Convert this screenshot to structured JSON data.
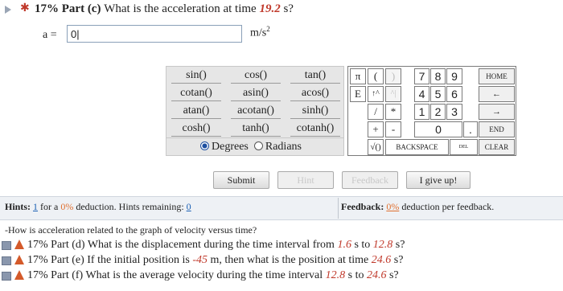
{
  "question": {
    "percent": "17%",
    "part": "Part (c)",
    "text_before": "What is the acceleration at time",
    "time_value": "19.2",
    "text_after": "s?",
    "var_label": "a =",
    "answer_value": "0|",
    "unit": "m/s",
    "unit_exp": "2"
  },
  "functions": [
    [
      "sin()",
      "cos()",
      "tan()"
    ],
    [
      "cotan()",
      "asin()",
      "acos()"
    ],
    [
      "atan()",
      "acotan()",
      "sinh()"
    ],
    [
      "cosh()",
      "tanh()",
      "cotanh()"
    ]
  ],
  "angle": {
    "degrees": "Degrees",
    "radians": "Radians",
    "selected": "degrees"
  },
  "keypad": {
    "pi": "π",
    "lparen": "(",
    "rparen": ")",
    "e": "E",
    "pow": "↑^",
    "caret": "^|",
    "div": "/",
    "mul": "*",
    "plus": "+",
    "minus": "-",
    "sqrt": "√()",
    "backspace": "BACKSPACE",
    "digits": [
      "7",
      "8",
      "9",
      "4",
      "5",
      "6",
      "1",
      "2",
      "3",
      "0",
      "."
    ],
    "home": "HOME",
    "left": "←",
    "right": "→",
    "end": "END",
    "del": "DEL",
    "clear": "CLEAR"
  },
  "buttons": {
    "submit": "Submit",
    "hint": "Hint",
    "feedback": "Feedback",
    "giveup": "I give up!"
  },
  "hints": {
    "label": "Hints:",
    "count": "1",
    "for_a": "for a",
    "pct": "0%",
    "deduction": "deduction. Hints remaining:",
    "remaining": "0"
  },
  "feedback": {
    "label": "Feedback:",
    "pct": "0%",
    "text": "deduction per feedback."
  },
  "hint_note": "-How is acceleration related to the graph of velocity versus time?",
  "other_parts": [
    {
      "percent": "17%",
      "part": "Part (d)",
      "pre": "What is the displacement during the time interval from",
      "v1": "1.6",
      "mid": "s to",
      "v2": "12.8",
      "post": "s?"
    },
    {
      "percent": "17%",
      "part": "Part (e)",
      "pre": "If the initial position is",
      "v1": "-45",
      "mid": "m, then what is the position at time",
      "v2": "24.6",
      "post": "s?"
    },
    {
      "percent": "17%",
      "part": "Part (f)",
      "pre": "What is the average velocity during the time interval",
      "v1": "12.8",
      "mid": "s to",
      "v2": "24.6",
      "post": "s?"
    }
  ],
  "colors": {
    "accent_red": "#c0392b",
    "link_blue": "#1a5fb4",
    "bar_bg": "#eef1f5"
  }
}
